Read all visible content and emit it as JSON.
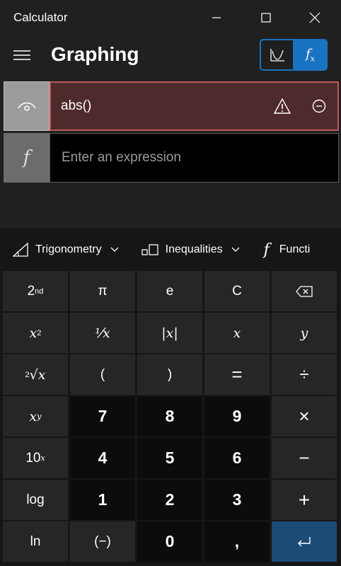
{
  "window": {
    "title": "Calculator",
    "icons": [
      "minimize-icon",
      "maximize-icon",
      "close-icon"
    ]
  },
  "header": {
    "menu_icon": "hamburger-menu-icon",
    "mode_title": "Graphing",
    "toggle": {
      "graph_icon": "graph-view-icon",
      "function_label": "f",
      "function_sub": "x"
    }
  },
  "expressions": [
    {
      "visibility_icon": "eye-icon",
      "text": "abs()",
      "status_icon": "warning-icon",
      "remove_icon": "remove-icon"
    },
    {
      "function_icon_label": "f",
      "placeholder": "Enter an expression"
    }
  ],
  "tabs": [
    {
      "label": "Trigonometry",
      "icon": "trigonometry-icon"
    },
    {
      "label": "Inequalities",
      "icon": "inequalities-icon"
    },
    {
      "label": "Functi",
      "icon": "function-icon"
    }
  ],
  "keys": {
    "second_base": "2",
    "second_sup": "nd",
    "pi": "π",
    "e": "e",
    "clear": "C",
    "square_base": "x",
    "square_sup": "2",
    "reciprocal": "⅟x",
    "abs": "|x|",
    "var_x": "x",
    "var_y": "y",
    "root_index": "2",
    "root_sym": "√x",
    "open_paren": "(",
    "close_paren": ")",
    "equals": "=",
    "divide": "÷",
    "power_base": "x",
    "power_sup": "y",
    "seven": "7",
    "eight": "8",
    "nine": "9",
    "multiply": "×",
    "ten_base": "10",
    "ten_sup": "x",
    "four": "4",
    "five": "5",
    "six": "6",
    "minus": "−",
    "log": "log",
    "one": "1",
    "two": "2",
    "three": "3",
    "plus": "+",
    "ln": "ln",
    "negate": "(−)",
    "zero": "0",
    "decimal": ",",
    "enter_icon": "enter-icon"
  },
  "colors": {
    "accent": "#1a73c2",
    "error_bg": "#4f2a2c",
    "error_border": "#c2575a",
    "enter_key": "#1c4b78"
  }
}
